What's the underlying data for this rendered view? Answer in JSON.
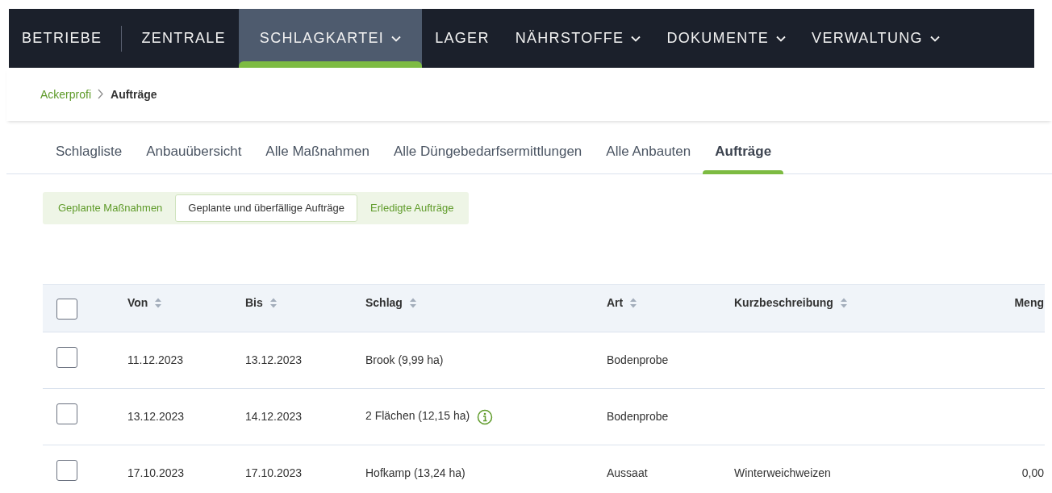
{
  "main_nav": [
    {
      "kind": "link",
      "label": "BETRIEBE",
      "selected": false,
      "dropdown": false
    },
    {
      "kind": "separator"
    },
    {
      "kind": "link",
      "label": "ZENTRALE",
      "selected": false,
      "dropdown": false
    },
    {
      "kind": "link",
      "label": "SCHLAGKARTEI",
      "selected": true,
      "dropdown": true
    },
    {
      "kind": "link",
      "label": "LAGER",
      "selected": false,
      "dropdown": false
    },
    {
      "kind": "link",
      "label": "NÄHRSTOFFE",
      "selected": false,
      "dropdown": true
    },
    {
      "kind": "link",
      "label": "DOKUMENTE",
      "selected": false,
      "dropdown": true
    },
    {
      "kind": "link",
      "label": "VERWALTUNG",
      "selected": false,
      "dropdown": true
    }
  ],
  "breadcrumb": [
    {
      "label": "Ackerprofi",
      "current": false
    },
    {
      "label": "Aufträge",
      "current": true
    }
  ],
  "sub_tabs": [
    {
      "label": "Schlagliste",
      "selected": false
    },
    {
      "label": "Anbauübersicht",
      "selected": false
    },
    {
      "label": "Alle Maßnahmen",
      "selected": false
    },
    {
      "label": "Alle Düngebedarfsermittlungen",
      "selected": false
    },
    {
      "label": "Alle Anbauten",
      "selected": false
    },
    {
      "label": "Aufträge",
      "selected": true
    }
  ],
  "filter": [
    {
      "label": "Geplante Maßnahmen",
      "selected": false
    },
    {
      "label": "Geplante und überfällige Aufträge",
      "selected": true
    },
    {
      "label": "Erledigte Aufträge",
      "selected": false
    }
  ],
  "table": {
    "select_all_checked": false,
    "columns": [
      {
        "label": "Von",
        "sortable": true
      },
      {
        "label": "Bis",
        "sortable": true
      },
      {
        "label": "Schlag",
        "sortable": true
      },
      {
        "label": "Art",
        "sortable": true
      },
      {
        "label": "Kurzbeschreibung",
        "sortable": true
      },
      {
        "label": "Meng",
        "sortable": false
      }
    ],
    "rows": [
      {
        "checked": false,
        "cells": [
          "11.12.2023",
          "13.12.2023",
          "Brook (9,99 ha)",
          "Bodenprobe",
          "",
          ""
        ],
        "info": false
      },
      {
        "checked": false,
        "cells": [
          "13.12.2023",
          "14.12.2023",
          "2 Flächen (12,15 ha)",
          "Bodenprobe",
          "",
          ""
        ],
        "info": true
      },
      {
        "checked": false,
        "cells": [
          "17.10.2023",
          "17.10.2023",
          "Hofkamp (13,24 ha)",
          "Aussaat",
          "Winterweichweizen",
          "0,00"
        ],
        "info": false
      }
    ]
  }
}
